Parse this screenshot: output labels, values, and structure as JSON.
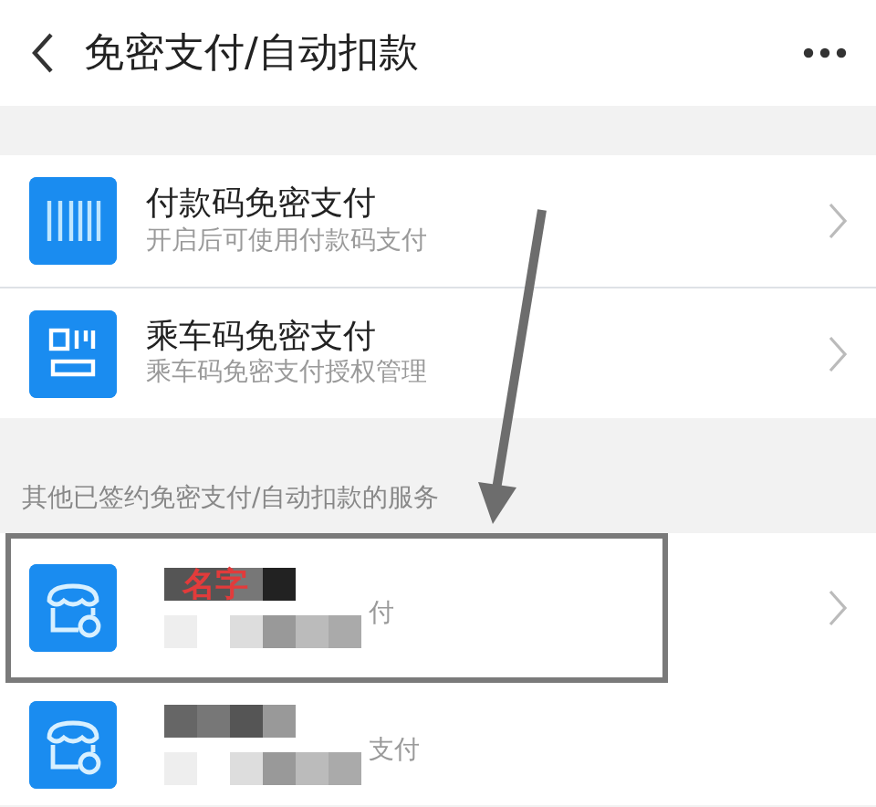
{
  "header": {
    "title": "免密支付/自动扣款"
  },
  "items": [
    {
      "kind": "barcode",
      "title": "付款码免密支付",
      "subtitle": "开启后可使用付款码支付"
    },
    {
      "kind": "transit",
      "title": "乘车码免密支付",
      "subtitle": "乘车码免密支付授权管理"
    }
  ],
  "section_label": "其他已签约免密支付/自动扣款的服务",
  "services": [
    {
      "annotation": "名字",
      "subtitle": "付",
      "highlighted": true,
      "chevron": true
    },
    {
      "subtitle": "支付",
      "highlighted": false,
      "chevron": false
    }
  ]
}
